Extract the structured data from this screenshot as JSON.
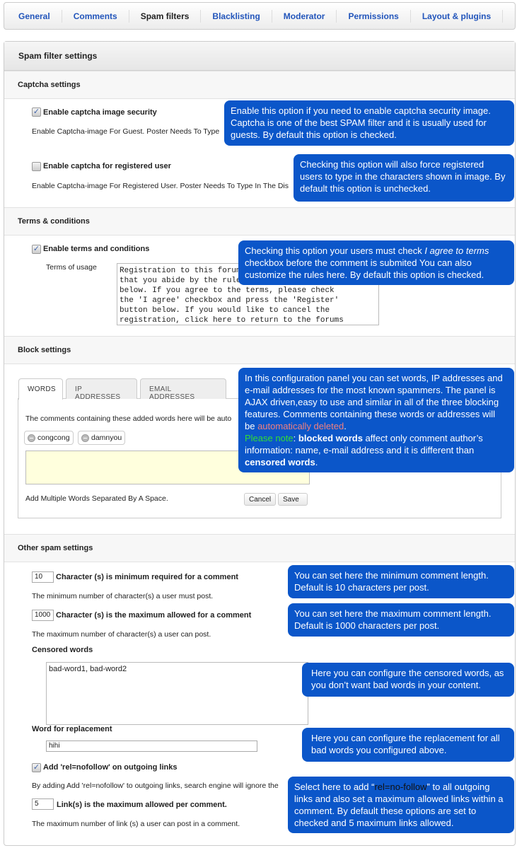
{
  "tabs": [
    {
      "label": "General",
      "active": false
    },
    {
      "label": "Comments",
      "active": false
    },
    {
      "label": "Spam filters",
      "active": true
    },
    {
      "label": "Blacklisting",
      "active": false
    },
    {
      "label": "Moderator",
      "active": false
    },
    {
      "label": "Permissions",
      "active": false
    },
    {
      "label": "Layout & plugins",
      "active": false
    }
  ],
  "panel_title": "Spam filter settings",
  "captcha": {
    "header": "Captcha settings",
    "guest": {
      "label": "Enable captcha image security",
      "checked": true,
      "desc": "Enable Captcha-image For Guest. Poster Needs To Type",
      "tip": "Enable this option if you need to enable captcha security image. Captcha is one of the best SPAM filter and it is usually used for guests. By default this option is checked."
    },
    "registered": {
      "label": "Enable captcha for registered user",
      "checked": false,
      "desc": "Enable Captcha-image For Registered User. Poster Needs To Type In The Dis",
      "tip": "Checking this option will also force registered users to type in the characters shown in image. By default this option is unchecked."
    }
  },
  "terms": {
    "header": "Terms & conditions",
    "label": "Enable terms and conditions",
    "checked": true,
    "usage_label": "Terms of usage",
    "usage_text": "Registration to this forum\nthat you abide by the rules\nbelow. If you agree to the terms, please check\nthe 'I agree' checkbox and press the 'Register'\nbutton below. If you would like to cancel the\nregistration, click here to return to the forums",
    "tip_pre": "Checking this option your users must check ",
    "tip_em": "I agree to terms",
    "tip_post": " checkbox before the comment is submited You can also customize the rules here. By default this option is checked."
  },
  "block": {
    "header": "Block settings",
    "tabs": [
      "WORDS",
      "IP ADDRESSES",
      "EMAIL ADDRESSES"
    ],
    "desc": "The comments containing these added words here will be auto",
    "words": [
      "congcong",
      "damnyou"
    ],
    "hint": "Add Multiple Words Separated By A Space.",
    "cancel": "Cancel",
    "save": "Save",
    "tip": {
      "p1": "In this configuration panel you can set words, IP addresses and e-mail addresses for the most known spammers. The panel is AJAX driven,easy to use and similar in all of the three blocking features. Comments containing these words or addresses will be ",
      "deleted": "automatically deleted",
      "p2": ".",
      "note": "Please note",
      "p3": ": ",
      "b1": "blocked words",
      "p4": " affect only comment author’s information: name, e-mail address and it is different than ",
      "b2": "censored words",
      "p5": "."
    },
    "colors": {
      "deleted": "#f08080",
      "note": "#33dd33"
    }
  },
  "other": {
    "header": "Other spam settings",
    "min": {
      "value": "10",
      "label": "Character (s) is minimum required for a comment",
      "desc": "The minimum number of character(s) a user must post.",
      "tip": "You can set here the minimum comment length. Default is 10 characters per post."
    },
    "max": {
      "value": "1000",
      "label": "Character (s) is the maximum allowed for a comment",
      "desc": "The maximum number of character(s) a user can post.",
      "tip": "You can set here the maximum comment length. Default is 1000 characters per post."
    },
    "censored": {
      "label": "Censored words",
      "value": "bad-word1, bad-word2",
      "tip": "Here you can configure the censored words, as you don’t want bad words in your content."
    },
    "replacement": {
      "label": "Word for replacement",
      "value": "hihi",
      "tip": "Here you can configure the replacement for all bad words you configured above."
    },
    "nofollow": {
      "label": "Add 'rel=nofollow' on outgoing links",
      "checked": true,
      "desc": "By adding Add 'rel=nofollow' to outgoing links, search engine will ignore the"
    },
    "links": {
      "value": "5",
      "label": "Link(s) is the maximum allowed per comment.",
      "desc": "The maximum number of link (s) a user can post in a comment."
    },
    "tip_links": {
      "p1": "Select here to add “",
      "code": "rel=no-follow",
      "p2": "” to all outgoing links and also set a maximum allowed links within a comment. By default these options are set to checked and 5 maximum links allowed."
    }
  },
  "colors": {
    "tooltip": "#0b56c9",
    "link": "#2255bb"
  }
}
